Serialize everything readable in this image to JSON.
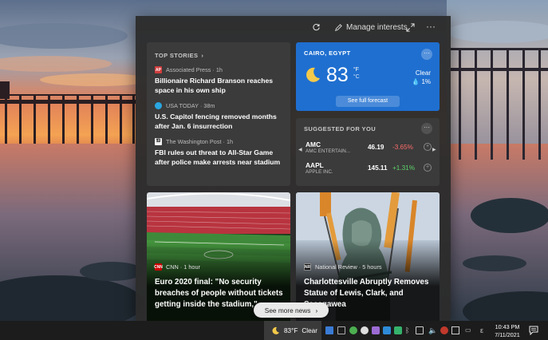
{
  "header": {
    "manage_interests_label": "Manage interests"
  },
  "top_stories": {
    "title": "TOP STORIES",
    "stories": [
      {
        "source": "Associated Press · 1h",
        "source_logo": "AP",
        "headline": "Billionaire Richard Branson reaches space in his own ship"
      },
      {
        "source": "USA TODAY · 38m",
        "source_logo": "",
        "headline": "U.S. Capitol fencing removed months after Jan. 6 insurrection"
      },
      {
        "source": "The Washington Post · 1h",
        "source_logo": "",
        "headline": "FBI rules out threat to All-Star Game after police make arrests near stadium"
      }
    ]
  },
  "weather": {
    "location": "CAIRO, EGYPT",
    "temperature": "83",
    "unit_f": "°F",
    "unit_c": "°C",
    "condition": "Clear",
    "precipitation": "1%",
    "forecast_button": "See full forecast"
  },
  "suggested": {
    "title": "SUGGESTED FOR YOU",
    "stocks": [
      {
        "symbol": "AMC",
        "name": "AMC ENTERTAIN...",
        "price": "46.19",
        "change": "-3.65%",
        "direction": "down"
      },
      {
        "symbol": "AAPL",
        "name": "APPLE INC.",
        "price": "145.11",
        "change": "+1.31%",
        "direction": "up"
      }
    ]
  },
  "news_cards": [
    {
      "source": "CNN · 1 hour",
      "source_logo": "CNN",
      "headline": "Euro 2020 final: \"No security breaches of people without tickets getting inside the stadium,\" ..."
    },
    {
      "source": "National Review · 5 hours",
      "source_logo": "NR",
      "headline": "Charlottesville Abruptly Removes Statue of Lewis, Clark, and Sacagawea"
    }
  ],
  "see_more_label": "See more news",
  "taskbar": {
    "weather_temp": "83°F",
    "weather_condition": "Clear",
    "clock_time": "10:43 PM",
    "clock_date": "7/11/2021"
  },
  "colors": {
    "weather_card": "#1f6fd0",
    "stock_down": "#ff6b6b",
    "stock_up": "#5ed36b",
    "flyout_bg": "#2c2c2c",
    "card_bg": "#3b3b3b"
  }
}
